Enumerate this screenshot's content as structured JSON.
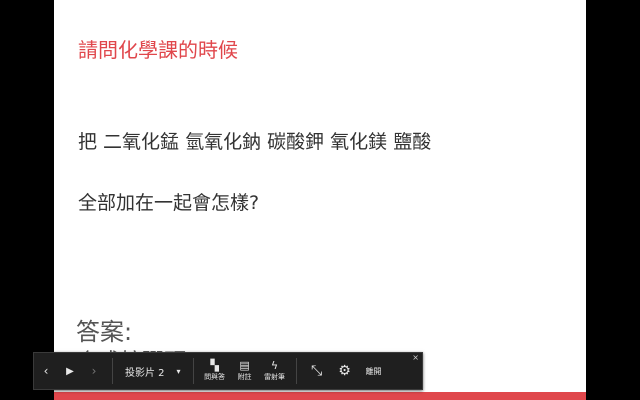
{
  "slide": {
    "title": "請問化學課的時候",
    "line1": "把 二氧化錳 氫氧化鈉 碳酸鉀 氧化鎂 鹽酸",
    "line2": "全部加在一起會怎樣?",
    "answer_heading": "答案:",
    "answer_partial": "合成核彈頭",
    "accent_color": "#e0474c"
  },
  "toolbar": {
    "prev_icon": "‹",
    "play_icon": "▶",
    "next_icon": "›",
    "slide_select_label": "投影片 2",
    "caret_icon": "▾",
    "qa_icon": "▚",
    "qa_label": "問與答",
    "notes_icon": "▤",
    "notes_label": "附註",
    "pointer_icon": "ϟ",
    "pointer_label": "雷射筆",
    "fullscreen_exit_icon": "⤡",
    "settings_icon": "⚙",
    "exit_label": "離開",
    "close_icon": "×"
  }
}
